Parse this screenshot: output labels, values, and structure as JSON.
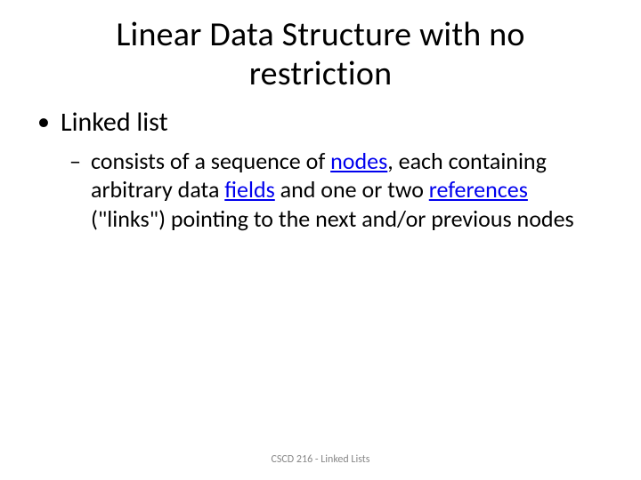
{
  "title_line1": "Linear Data Structure with no",
  "title_line2": "restriction",
  "bullet1": "Linked list",
  "sub_pre": "consists of a sequence of ",
  "sub_link1": "nodes",
  "sub_mid1": ", each containing arbitrary data ",
  "sub_link2": "fields",
  "sub_mid2": " and one or two ",
  "sub_link3": "references",
  "sub_post": " (\"links\") pointing to the next and/or previous nodes",
  "footer": "CSCD 216 - Linked Lists"
}
